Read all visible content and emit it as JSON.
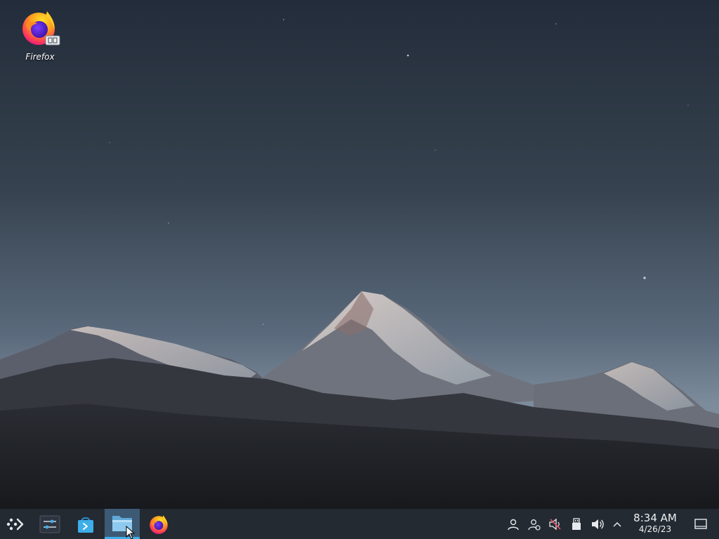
{
  "desktop": {
    "icons": [
      {
        "label": "Firefox",
        "icon": "firefox-icon",
        "badge": "link-emblem"
      }
    ]
  },
  "taskbar": {
    "launcher": {
      "icon": "application-launcher-icon"
    },
    "tasks": [
      {
        "name": "System Settings",
        "icon": "system-settings-icon",
        "active": false
      },
      {
        "name": "Discover",
        "icon": "discover-store-icon",
        "active": false
      },
      {
        "name": "Dolphin",
        "icon": "dolphin-folder-icon",
        "active": true
      },
      {
        "name": "Firefox",
        "icon": "firefox-icon",
        "active": false
      }
    ],
    "tray": [
      {
        "name": "user-icon"
      },
      {
        "name": "user-switch-icon"
      },
      {
        "name": "audio-muted-icon"
      },
      {
        "name": "removable-device-icon"
      },
      {
        "name": "volume-icon"
      },
      {
        "name": "expand-tray-chevron-icon"
      }
    ],
    "clock": {
      "time": "8:34 AM",
      "date": "4/26/23"
    },
    "show_desktop": {
      "icon": "show-desktop-icon"
    }
  },
  "colors": {
    "taskbar_bg": "#242a31",
    "active_task_bg": "#3d5a75",
    "accent": "#3daee9",
    "sky_top": "#242d3b",
    "sky_bottom": "#7f8fa0"
  }
}
